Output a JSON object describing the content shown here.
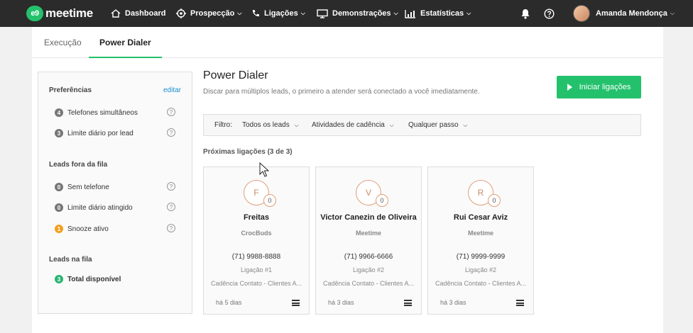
{
  "brand": {
    "badge": "e9",
    "name": "meetime"
  },
  "nav": [
    {
      "label": "Dashboard",
      "icon": "home-icon",
      "dropdown": false
    },
    {
      "label": "Prospecção",
      "icon": "target-icon",
      "dropdown": true
    },
    {
      "label": "Ligações",
      "icon": "phone-icon",
      "dropdown": true
    },
    {
      "label": "Demonstrações",
      "icon": "monitor-icon",
      "dropdown": true
    },
    {
      "label": "Estatísticas",
      "icon": "chart-icon",
      "dropdown": true
    }
  ],
  "user": {
    "name": "Amanda Mendonça"
  },
  "tabs": [
    {
      "label": "Execução",
      "active": false
    },
    {
      "label": "Power Dialer",
      "active": true
    }
  ],
  "sidebar": {
    "preferences": {
      "title": "Preferências",
      "edit": "editar",
      "items": [
        {
          "count": "4",
          "label": "Telefones simultâneos",
          "help": "?"
        },
        {
          "count": "3",
          "label": "Limite diário por lead",
          "help": "?"
        }
      ]
    },
    "outside": {
      "title": "Leads fora da fila",
      "items": [
        {
          "count": "0",
          "label": "Sem telefone",
          "help": "?"
        },
        {
          "count": "0",
          "label": "Limite diário atingido",
          "help": "?"
        },
        {
          "count": "1",
          "label": "Snooze ativo",
          "help": "?"
        }
      ]
    },
    "queue": {
      "title": "Leads na fila",
      "items": [
        {
          "count": "3",
          "label": "Total disponível"
        }
      ]
    }
  },
  "main": {
    "title": "Power Dialer",
    "subtitle": "Discar para múltiplos leads, o primeiro a atender será conectado a você imediatamente.",
    "start_button": "Iniciar ligações",
    "filter": {
      "label": "Filtro:",
      "options": [
        "Todos os leads",
        "Atividades de cadência",
        "Qualquer passo"
      ]
    },
    "next_calls_title": "Próximas ligações (3 de 3)"
  },
  "cards": [
    {
      "initial": "F",
      "count": "0",
      "name": "Freitas",
      "company": "CrocBuds",
      "phone": "(71) 9988-8888",
      "call": "Ligação #1",
      "cadence": "Cadência Contato - Clientes A...",
      "time": "há 5 dias"
    },
    {
      "initial": "V",
      "count": "0",
      "name": "Victor Canezin de Oliveira",
      "company": "Meetime",
      "phone": "(71) 9966-6666",
      "call": "Ligação #2",
      "cadence": "Cadência Contato - Clientes A...",
      "time": "há 3 dias"
    },
    {
      "initial": "R",
      "count": "0",
      "name": "Rui Cesar Aviz",
      "company": "Meetime",
      "phone": "(71) 9999-9999",
      "call": "Ligação #2",
      "cadence": "Cadência Contato - Clientes A...",
      "time": "há 3 dias"
    }
  ],
  "colors": {
    "accent": "#24c16c",
    "topbar": "#2b2b2b",
    "link": "#1a8fd1",
    "badge_gray": "#777777",
    "badge_orange": "#f0a020",
    "badge_green": "#2bb573"
  }
}
